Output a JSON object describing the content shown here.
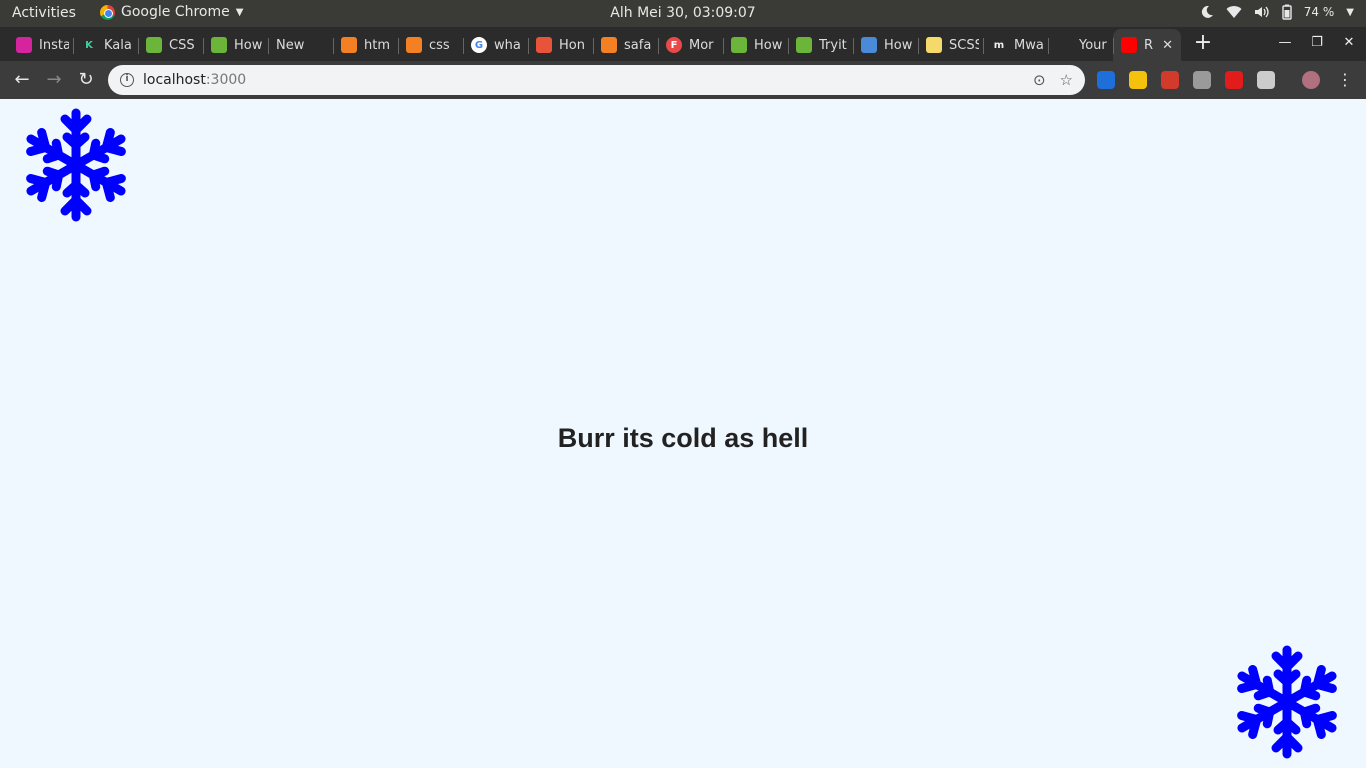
{
  "system_bar": {
    "activities": "Activities",
    "app_name": "Google Chrome",
    "clock": "Alh Mei 30, 03:09:07",
    "battery": "74 %"
  },
  "tabs": [
    {
      "title": "Insta",
      "favicon": "instagram-icon",
      "color": "#d6249f"
    },
    {
      "title": "Kala",
      "favicon": "kala-icon",
      "color": "#2b2b2b"
    },
    {
      "title": "CSS",
      "favicon": "w3schools-icon",
      "color": "#6bb53a"
    },
    {
      "title": "How",
      "favicon": "w3schools-icon",
      "color": "#6bb53a"
    },
    {
      "title": "New Tab",
      "favicon": "",
      "color": "#2b2b2b"
    },
    {
      "title": "htm",
      "favicon": "stackoverflow-icon",
      "color": "#f48024"
    },
    {
      "title": "css",
      "favicon": "stackoverflow-icon",
      "color": "#f48024"
    },
    {
      "title": "wha",
      "favicon": "google-icon",
      "color": "#ffffff"
    },
    {
      "title": "Hon",
      "favicon": "hon-icon",
      "color": "#e8543a"
    },
    {
      "title": "safa",
      "favicon": "stackoverflow-icon",
      "color": "#f48024"
    },
    {
      "title": "Mor",
      "favicon": "f-icon",
      "color": "#e84a4a"
    },
    {
      "title": "How",
      "favicon": "w3schools-icon",
      "color": "#6bb53a"
    },
    {
      "title": "Tryit",
      "favicon": "w3schools-icon",
      "color": "#6bb53a"
    },
    {
      "title": "How",
      "favicon": "loading-icon",
      "color": "#4a8ad8"
    },
    {
      "title": "SCSS",
      "favicon": "scss-icon",
      "color": "#f5d96b"
    },
    {
      "title": "Mwa",
      "favicon": "m-icon",
      "color": "#2b2b2b"
    },
    {
      "title": "Your",
      "favicon": "github-icon",
      "color": "#2b2b2b"
    },
    {
      "title": "R",
      "favicon": "youtube-icon",
      "color": "#ff0000",
      "active": true
    }
  ],
  "address_bar": {
    "host": "localhost",
    "port": ":3000"
  },
  "extensions": [
    {
      "name": "extension-1-icon",
      "color": "#1e6fd9"
    },
    {
      "name": "extension-2-icon",
      "color": "#f4c20d"
    },
    {
      "name": "extension-3-icon",
      "color": "#d23b2b"
    },
    {
      "name": "extension-4-icon",
      "color": "#9a9a9a"
    },
    {
      "name": "extension-5-icon",
      "color": "#e21b1b"
    },
    {
      "name": "extension-6-icon",
      "color": "#cccccc"
    }
  ],
  "page": {
    "headline": "Burr its cold as hell",
    "snowflake_color": "#0000ff"
  }
}
